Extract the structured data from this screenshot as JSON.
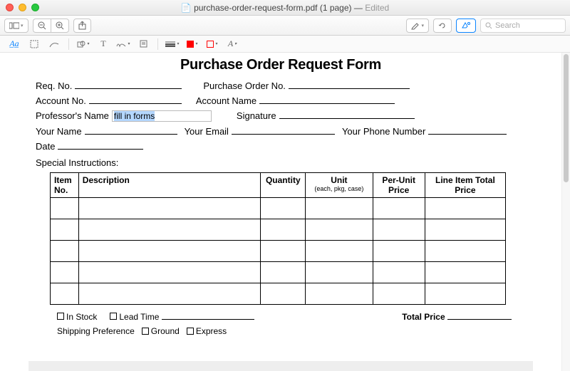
{
  "window": {
    "filename": "purchase-order-request-form.pdf (1 page)",
    "edited": "Edited",
    "search_placeholder": "Search"
  },
  "markup": {
    "textbox": "A̲a̲"
  },
  "form": {
    "title": "Purchase Order Request Form",
    "labels": {
      "req_no": "Req. No.",
      "po_no": "Purchase Order No.",
      "account_no": "Account No.",
      "account_name": "Account Name",
      "professor_name": "Professor's Name",
      "signature": "Signature",
      "your_name": "Your Name",
      "your_email": "Your Email",
      "your_phone": "Your Phone Number",
      "date": "Date",
      "special_instructions": "Special Instructions:",
      "in_stock": "In Stock",
      "lead_time": "Lead Time",
      "total_price": "Total Price",
      "shipping_pref": "Shipping Preference",
      "ground": "Ground",
      "express": "Express"
    },
    "fields": {
      "professor_name_value": "fill in forms"
    },
    "table": {
      "headers": {
        "item_no": "Item No.",
        "description": "Description",
        "quantity": "Quantity",
        "unit": "Unit",
        "unit_sub": "(each, pkg, case)",
        "per_unit_price": "Per-Unit Price",
        "line_total": "Line Item Total Price"
      }
    }
  }
}
